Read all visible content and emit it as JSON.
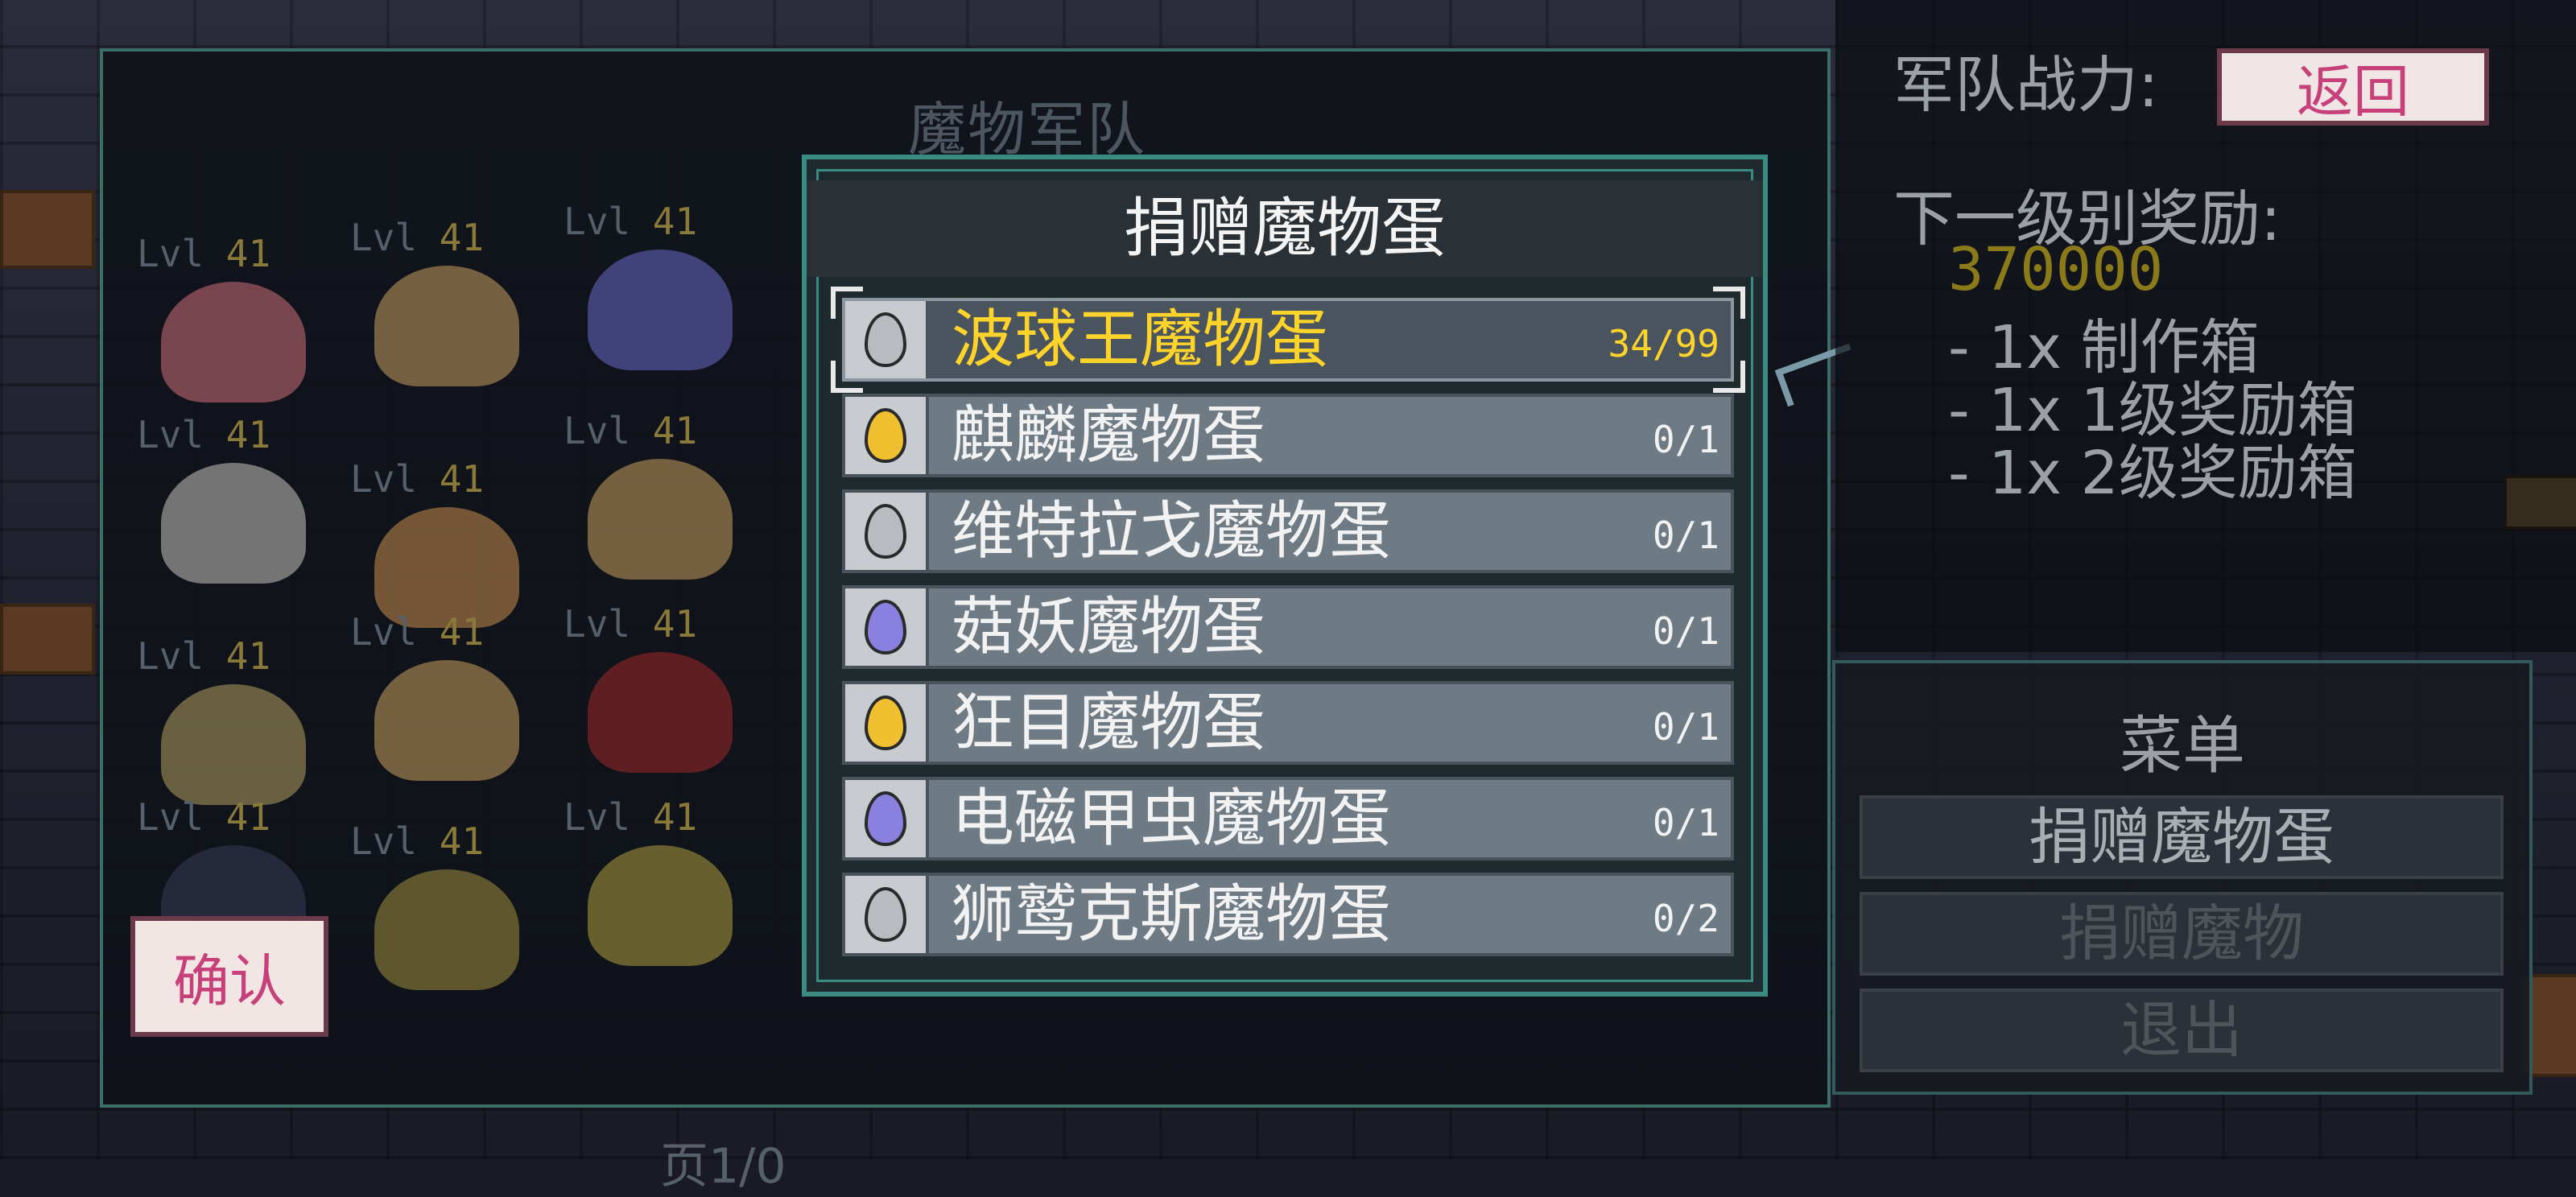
{
  "army_panel": {
    "title": "魔物军队",
    "confirm_label": "确认",
    "page_indicator": "页1/0",
    "units": [
      {
        "lvl_prefix": "Lvl",
        "level": "41",
        "color": "#d0707a"
      },
      {
        "lvl_prefix": "Lvl",
        "level": "41",
        "color": "#c9a060"
      },
      {
        "lvl_prefix": "Lvl",
        "level": "41",
        "color": "#6a6ac8"
      },
      {
        "lvl_prefix": "Lvl",
        "level": "41",
        "color": "#c8c4c0"
      },
      {
        "lvl_prefix": "Lvl",
        "level": "41",
        "color": "#c89050"
      },
      {
        "lvl_prefix": "Lvl",
        "level": "41",
        "color": "#c9a060"
      },
      {
        "lvl_prefix": "Lvl",
        "level": "41",
        "color": "#b0a060"
      },
      {
        "lvl_prefix": "Lvl",
        "level": "41",
        "color": "#c9a060"
      },
      {
        "lvl_prefix": "Lvl",
        "level": "41",
        "color": "#a02a2a"
      },
      {
        "lvl_prefix": "Lvl",
        "level": "41",
        "color": "#3a3a5a"
      },
      {
        "lvl_prefix": "Lvl",
        "level": "41",
        "color": "#a09040"
      },
      {
        "lvl_prefix": "Lvl",
        "level": "41",
        "color": "#b0a040"
      }
    ]
  },
  "dialog": {
    "title": "捐赠魔物蛋",
    "eggs": [
      {
        "name": "波球王魔物蛋",
        "count": "34/99",
        "egg_color": "#b8bcc0",
        "selected": true
      },
      {
        "name": "麒麟魔物蛋",
        "count": "0/1",
        "egg_color": "#f0c030",
        "selected": false
      },
      {
        "name": "维特拉戈魔物蛋",
        "count": "0/1",
        "egg_color": "#b8bcc0",
        "selected": false
      },
      {
        "name": "菇妖魔物蛋",
        "count": "0/1",
        "egg_color": "#8a80e0",
        "selected": false
      },
      {
        "name": "狂目魔物蛋",
        "count": "0/1",
        "egg_color": "#f0c030",
        "selected": false
      },
      {
        "name": "电磁甲虫魔物蛋",
        "count": "0/1",
        "egg_color": "#8a80e0",
        "selected": false
      },
      {
        "name": "狮鹫克斯魔物蛋",
        "count": "0/2",
        "egg_color": "#b8bcc0",
        "selected": false
      }
    ]
  },
  "info": {
    "power_label": "军队战力:",
    "back_label": "返回",
    "next_reward_label": "下一级别奖励:",
    "reward_value": "370000",
    "reward_items": [
      "- 1x 制作箱",
      "- 1x 1级奖励箱",
      "- 1x 2级奖励箱"
    ]
  },
  "menu": {
    "title": "菜单",
    "items": [
      {
        "label": "捐赠魔物蛋",
        "active": true
      },
      {
        "label": "捐赠魔物",
        "active": false
      },
      {
        "label": "退出",
        "active": false
      }
    ]
  },
  "colors": {
    "accent_teal": "#3a8c80",
    "selected_text": "#ffd42a",
    "confirm_text": "#c8407a"
  }
}
